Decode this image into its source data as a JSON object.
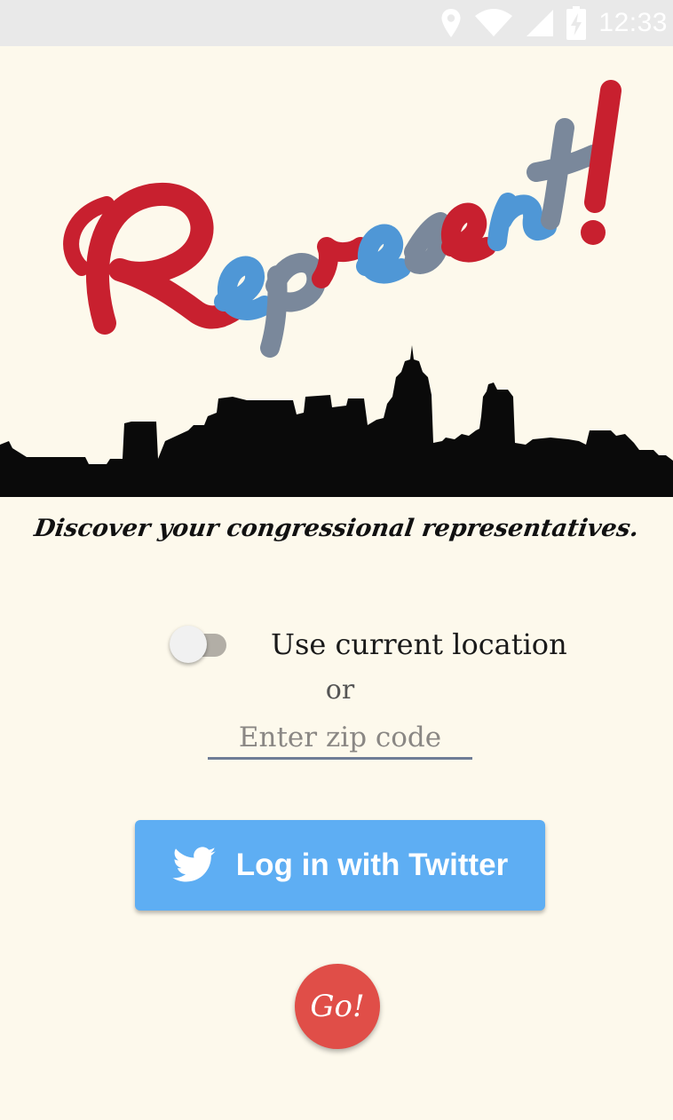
{
  "status_bar": {
    "time": "12:33",
    "icons": [
      "location-icon",
      "wifi-icon",
      "cell-signal-icon",
      "battery-charging-icon"
    ]
  },
  "logo": {
    "text": "Represent!",
    "colors": {
      "red": "#c8202f",
      "blue": "#4f97d6",
      "gray": "#7a889b"
    }
  },
  "tagline": "Discover your congressional representatives.",
  "location": {
    "toggle_label": "Use current location",
    "toggle_on": false,
    "or_text": "or",
    "zip_placeholder": "Enter zip code",
    "zip_value": ""
  },
  "twitter": {
    "label": "Log in with Twitter",
    "icon": "twitter-bird-icon",
    "color": "#5eaef3"
  },
  "go": {
    "label": "Go!",
    "color": "#e04e48"
  },
  "background": "#fdf9ec"
}
